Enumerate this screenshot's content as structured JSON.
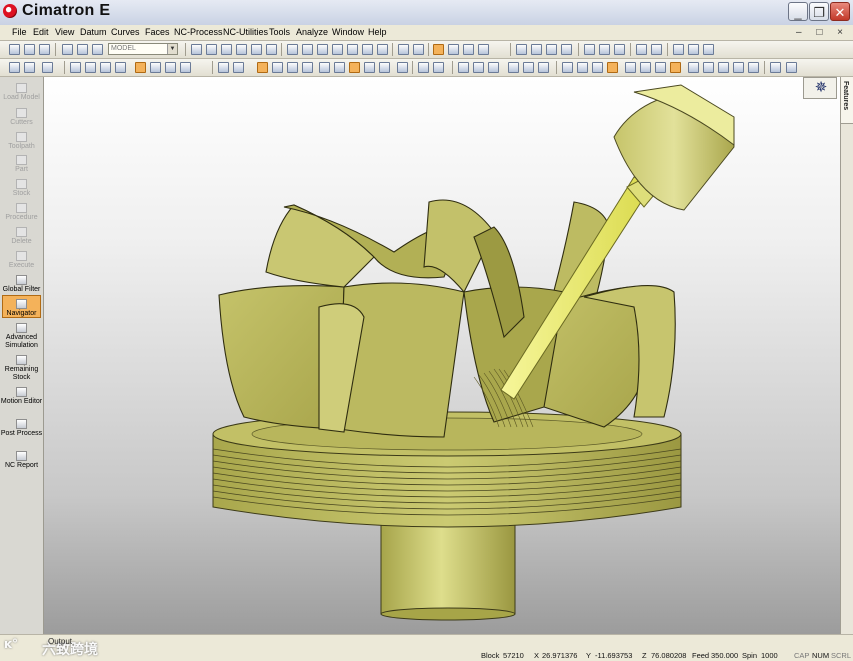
{
  "window": {
    "title": "Cimatron E",
    "minimize_glyph": "_",
    "maximize_glyph": "❐",
    "close_glyph": "✕"
  },
  "menu": {
    "items": [
      "File",
      "Edit",
      "View",
      "Datum",
      "Curves",
      "Faces",
      "NC-Process",
      "NC-Utilities",
      "Tools",
      "Analyze",
      "Window",
      "Help"
    ],
    "mdi_controls": "– □ ×"
  },
  "toolbar": {
    "model_combo_value": "MODEL"
  },
  "left_panel": {
    "items": [
      {
        "label": "Load Model",
        "enabled": false
      },
      {
        "label": "Cutters",
        "enabled": false
      },
      {
        "label": "Toolpath",
        "enabled": false
      },
      {
        "label": "Part",
        "enabled": false
      },
      {
        "label": "Stock",
        "enabled": false
      },
      {
        "label": "Procedure",
        "enabled": false
      },
      {
        "label": "Delete",
        "enabled": false
      },
      {
        "label": "Execute",
        "enabled": false
      },
      {
        "label": "Global Filter",
        "enabled": true
      },
      {
        "label": "Navigator",
        "enabled": true,
        "active": true
      },
      {
        "label": "Advanced Simulation",
        "enabled": true
      },
      {
        "label": "Remaining Stock",
        "enabled": true
      },
      {
        "label": "Motion Editor",
        "enabled": true
      },
      {
        "label": "Post Process",
        "enabled": true
      },
      {
        "label": "NC Report",
        "enabled": true
      }
    ]
  },
  "right_panel": {
    "features_tab": "Features"
  },
  "status_bar": {
    "output_label": "Output",
    "block_label": "Block",
    "block_value": "57210",
    "x_label": "X",
    "x_value": "26.971376",
    "y_label": "Y",
    "y_value": "-11.693753",
    "z_label": "Z",
    "z_value": "76.080208",
    "feed_label": "Feed",
    "feed_value": "350.000",
    "spin_label": "Spin",
    "spin_value": "1000",
    "indicators": [
      "CAP",
      "NUM",
      "SCRL"
    ]
  },
  "watermark": {
    "logo": "ᴋ°",
    "text": "六致跨境"
  },
  "colors": {
    "model_fill": "#b7b55a",
    "model_dark": "#8f8c36",
    "tool_yellow": "#e8e866",
    "active_orange": "#f4b25a"
  }
}
